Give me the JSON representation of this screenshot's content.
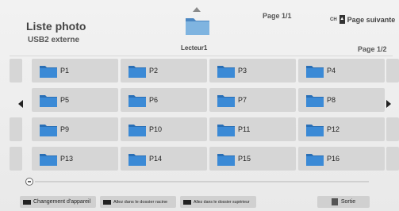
{
  "header": {
    "title": "Liste photo",
    "device": "USB2 externe",
    "current_folder": "Lecteur1",
    "page_indicator": "Page 1/1",
    "next_page_key": "CH",
    "next_page_label": "Page suivante",
    "page_right": "Page 1/2"
  },
  "grid": {
    "rows": [
      [
        "P1",
        "P2",
        "P3",
        "P4"
      ],
      [
        "P5",
        "P6",
        "P7",
        "P8"
      ],
      [
        "P9",
        "P10",
        "P11",
        "P12"
      ],
      [
        "P13",
        "P14",
        "P15",
        "P16"
      ]
    ]
  },
  "footer": {
    "change_device": "Changement d'appareil",
    "root_folder": "Allez dans le dossier racine",
    "upper_folder": "Allez dans le dossier supérieur",
    "exit": "Sortie"
  },
  "colors": {
    "folder_blue": "#2f7fc8",
    "folder_tab": "#6aa6d8",
    "cell_bg": "#d6d6d6"
  },
  "icons": [
    "folder-icon",
    "up-arrow-icon",
    "left-arrow-icon",
    "right-arrow-icon",
    "scroll-knob-icon"
  ]
}
